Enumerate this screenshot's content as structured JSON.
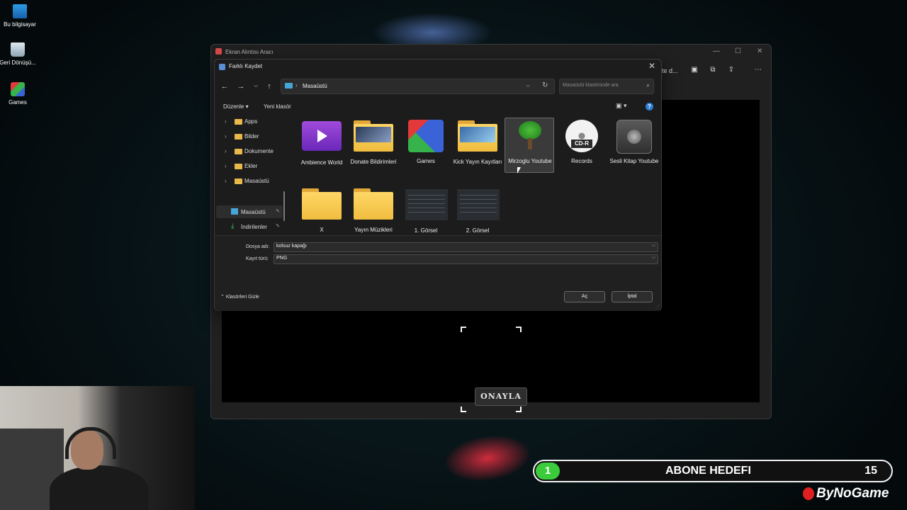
{
  "desktop": {
    "icons": [
      {
        "label": "Bu bilgisayar"
      },
      {
        "label": "Geri Dönüşü..."
      },
      {
        "label": "Games"
      }
    ]
  },
  "snip": {
    "title": "Ekran Alıntısı Aracı",
    "toolbar_text": "te d...",
    "canvas_button": "ONAYLA"
  },
  "dialog": {
    "title": "Farklı Kaydet",
    "address": {
      "current": "Masaüstü"
    },
    "search": {
      "placeholder": "Masaüstü klasöründe ara"
    },
    "commands": {
      "organize": "Düzenle",
      "new_folder": "Yeni klasör"
    },
    "sidebar": {
      "tree": [
        {
          "label": "Apps"
        },
        {
          "label": "Bilder"
        },
        {
          "label": "Dokumente"
        },
        {
          "label": "Ekler"
        },
        {
          "label": "Masaüstü"
        }
      ],
      "quick_access": [
        {
          "label": "Masaüstü"
        },
        {
          "label": "İndirilenler"
        }
      ]
    },
    "files": [
      {
        "name": "Ambience World",
        "icon": "video-folder-icon"
      },
      {
        "name": "Donate Bildirimleri",
        "icon": "folder-icon"
      },
      {
        "name": "Games",
        "icon": "games-icon"
      },
      {
        "name": "Kick Yayın Kayıtları",
        "icon": "folder-icon"
      },
      {
        "name": "Mirzoglu Youtube",
        "icon": "tree-icon"
      },
      {
        "name": "Records",
        "icon": "cd-icon"
      },
      {
        "name": "Sesli Kitap Youtube",
        "icon": "speaker-icon"
      },
      {
        "name": "X",
        "icon": "folder-icon"
      },
      {
        "name": "Yayın Müzikleri",
        "icon": "folder-icon"
      },
      {
        "name": "1. Görsel",
        "icon": "image-icon"
      },
      {
        "name": "2. Görsel",
        "icon": "image-icon"
      }
    ],
    "cd_tag": "CD-R",
    "filename": {
      "label": "Dosya adı:",
      "value": "kolsuz kapağı"
    },
    "filetype": {
      "label": "Kayıt türü:",
      "value": "PNG"
    },
    "hide_folders": "Klasörleri Gizle",
    "open_button": "Aç",
    "cancel_button": "İptal",
    "help": "?"
  },
  "overlay": {
    "sub_goal_label": "ABONE HEDEFI",
    "sub_goal_current": "1",
    "sub_goal_target": "15",
    "brand": "ByNoGame"
  }
}
